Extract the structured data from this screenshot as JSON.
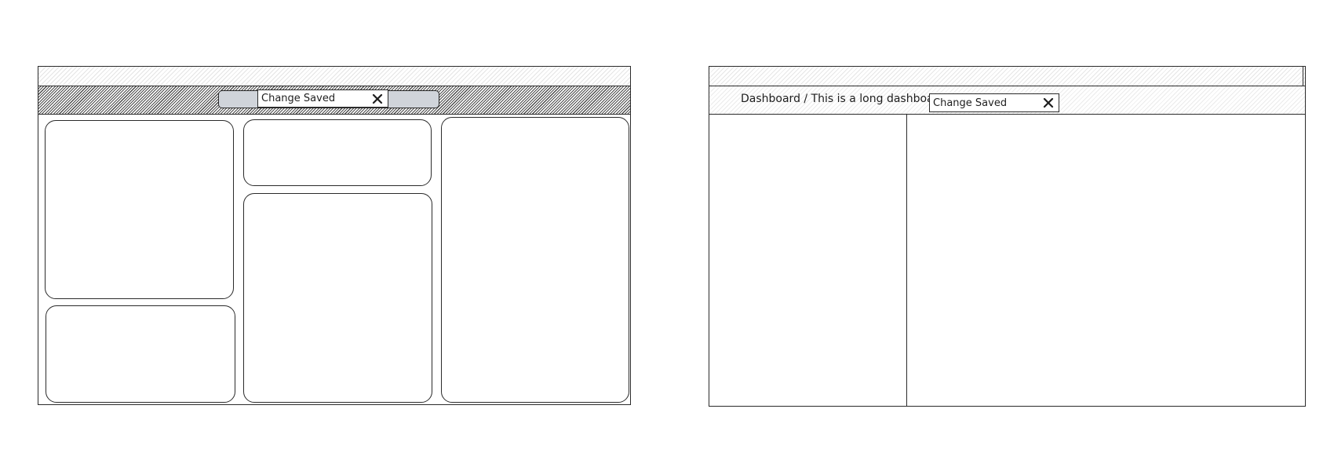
{
  "wireframe_a": {
    "toast": {
      "message": "Change Saved",
      "close_icon": "close-icon"
    }
  },
  "wireframe_b": {
    "breadcrumb": "Dashboard / This is a long dashboard name that's hidden",
    "toast": {
      "message": "Change Saved",
      "close_icon": "close-icon"
    }
  },
  "colors": {
    "stroke": "#2b2b2b",
    "pill_fill": "#d0d4da",
    "background": "#ffffff"
  }
}
